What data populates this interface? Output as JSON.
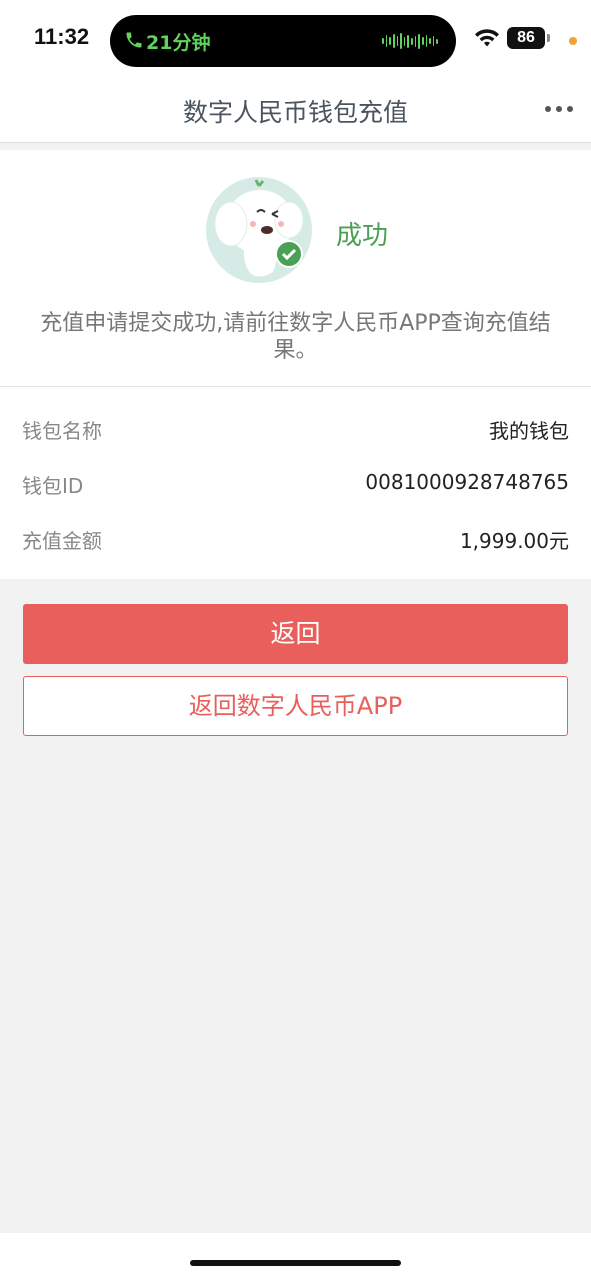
{
  "status_bar": {
    "time": "11:32",
    "call_duration": "21分钟",
    "battery": "86",
    "icons": [
      "phone-icon",
      "waveform-icon",
      "wifi-icon",
      "battery-icon"
    ]
  },
  "nav": {
    "title": "数字人民币钱包充值",
    "more_icon": "more-icon"
  },
  "result": {
    "status": "成功",
    "message": "充值申请提交成功,请前往数字人民币APP查询充值结果。",
    "mascot_icon": "elephant-mascot-check-icon"
  },
  "details": {
    "wallet_name": {
      "label": "钱包名称",
      "value": "我的钱包"
    },
    "wallet_id": {
      "label": "钱包ID",
      "value": "0081000928748765"
    },
    "amount": {
      "label": "充值金额",
      "value": "1,999.00元"
    }
  },
  "buttons": {
    "back": "返回",
    "back_to_app": "返回数字人民币APP"
  },
  "colors": {
    "accent_red": "#e85f5c",
    "success_green": "#4aa055",
    "call_green": "#5fd35b"
  }
}
